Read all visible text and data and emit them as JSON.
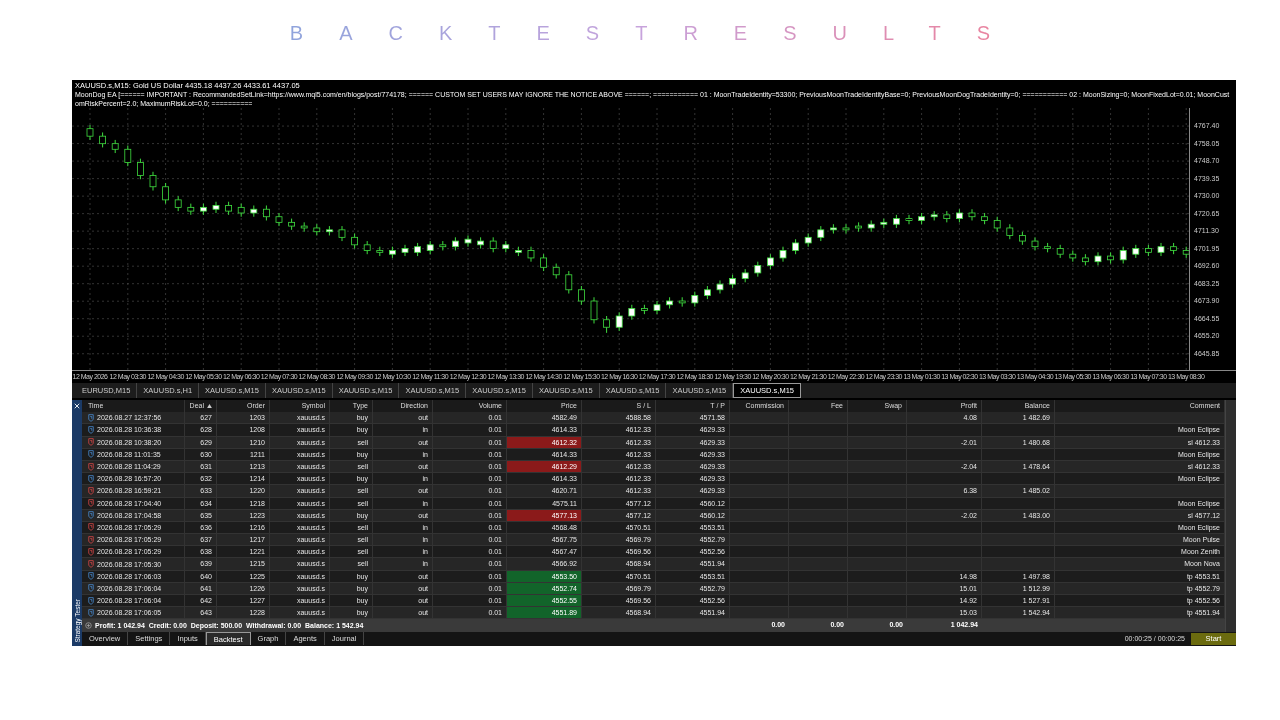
{
  "title": "BACKTESTRESULTS",
  "chart": {
    "symbol_line": "XAUUSD.s,M15:  Gold US Dollar  4435.18 4437.26 4433.61 4437.05",
    "ea_line": "MoonDog EA [====== IMPORTANT : RecommandedSetLink=https://www.mql5.com/en/blogs/post/774178; ====== CUSTOM SET USERS MAY IGNORE THE NOTICE ABOVE ======; =========== 01 : MoonTradeIdentity=53300; PreviousMoonTradeIdentityBase=0; PreviousMoonDogTradeIdentity=0; =========== 02 : MoonSizing=0; MoonFixedLot=0.01; MoonCustomRiskPercent=2.0; MaximumRiskLot=0.0; ==========",
    "chart_data": {
      "type": "candlestick",
      "grid": true,
      "ylim": [
        4637.17,
        4777.05
      ],
      "yticks": [
        {
          "value": 4767.4,
          "label": "4767.40"
        },
        {
          "value": 4758.05,
          "label": "4758.05"
        },
        {
          "value": 4748.7,
          "label": "4748.70"
        },
        {
          "value": 4739.35,
          "label": "4739.35"
        },
        {
          "value": 4730,
          "label": "4730.00"
        },
        {
          "value": 4720.65,
          "label": "4720.65"
        },
        {
          "value": 4711.3,
          "label": "4711.30"
        },
        {
          "value": 4701.95,
          "label": "4701.95"
        },
        {
          "value": 4692.6,
          "label": "4692.60"
        },
        {
          "value": 4683.25,
          "label": "4683.25"
        },
        {
          "value": 4673.9,
          "label": "4673.90"
        },
        {
          "value": 4664.55,
          "label": "4664.55"
        },
        {
          "value": 4655.2,
          "label": "4655.20"
        },
        {
          "value": 4645.85,
          "label": "4645.85"
        }
      ],
      "categories": [
        "12 May 2026",
        null,
        null,
        "12 May 03:30",
        null,
        null,
        "12 May 04:30",
        null,
        null,
        "12 May 05:30",
        null,
        null,
        "12 May 06:30",
        null,
        null,
        "12 May 07:30",
        null,
        null,
        "12 May 08:30",
        null,
        null,
        "12 May 09:30",
        null,
        null,
        "12 May 10:30",
        null,
        null,
        "12 May 11:30",
        null,
        null,
        "12 May 12:30",
        null,
        null,
        "12 May 13:30",
        null,
        null,
        "12 May 14:30",
        null,
        null,
        "12 May 15:30",
        null,
        null,
        "12 May 16:30",
        null,
        null,
        "12 May 17:30",
        null,
        null,
        "12 May 18:30",
        null,
        null,
        "12 May 19:30",
        null,
        null,
        "12 May 20:30",
        null,
        null,
        "12 May 21:30",
        null,
        null,
        "12 May 22:30",
        null,
        null,
        "12 May 23:30",
        null,
        null,
        "13 May 01:30",
        null,
        null,
        "13 May 02:30",
        null,
        null,
        "13 May 03:30",
        null,
        null,
        "13 May 04:30",
        null,
        null,
        "13 May 05:30",
        null,
        null,
        "13 May 06:30",
        null,
        null,
        "13 May 07:30",
        null,
        null,
        "13 May 08:30"
      ],
      "ohlc": [
        [
          4766,
          4768,
          4760,
          4762
        ],
        [
          4762,
          4764,
          4756,
          4758
        ],
        [
          4758,
          4760,
          4753,
          4755
        ],
        [
          4755,
          4757,
          4746,
          4748
        ],
        [
          4748,
          4750,
          4739,
          4741
        ],
        [
          4741,
          4743,
          4733,
          4735
        ],
        [
          4735,
          4737,
          4726,
          4728
        ],
        [
          4728,
          4730,
          4722,
          4724
        ],
        [
          4724,
          4726,
          4720,
          4722
        ],
        [
          4722,
          4726,
          4720,
          4724
        ],
        [
          4723,
          4727,
          4721,
          4725
        ],
        [
          4725,
          4727,
          4720,
          4722
        ],
        [
          4724,
          4726,
          4719,
          4721
        ],
        [
          4721,
          4725,
          4719,
          4723
        ],
        [
          4723,
          4725,
          4717,
          4719
        ],
        [
          4719,
          4721,
          4714,
          4716
        ],
        [
          4716,
          4718,
          4712,
          4714
        ],
        [
          4714,
          4716,
          4711,
          4713
        ],
        [
          4713,
          4715,
          4709,
          4711
        ],
        [
          4711,
          4714,
          4709,
          4712
        ],
        [
          4712,
          4714,
          4706,
          4708
        ],
        [
          4708,
          4710,
          4702,
          4704
        ],
        [
          4704,
          4706,
          4699,
          4701
        ],
        [
          4701,
          4703,
          4698,
          4700
        ],
        [
          4699,
          4703,
          4697,
          4701
        ],
        [
          4700,
          4704,
          4698,
          4702
        ],
        [
          4700,
          4705,
          4698,
          4703
        ],
        [
          4701,
          4706,
          4699,
          4704
        ],
        [
          4704,
          4706,
          4701,
          4703
        ],
        [
          4703,
          4708,
          4701,
          4706
        ],
        [
          4705,
          4709,
          4703,
          4707
        ],
        [
          4704,
          4708,
          4702,
          4706
        ],
        [
          4706,
          4708,
          4700,
          4702
        ],
        [
          4702,
          4706,
          4700,
          4704
        ],
        [
          4700,
          4703,
          4698,
          4701
        ],
        [
          4701,
          4703,
          4695,
          4697
        ],
        [
          4697,
          4699,
          4690,
          4692
        ],
        [
          4692,
          4694,
          4686,
          4688
        ],
        [
          4688,
          4690,
          4678,
          4680
        ],
        [
          4680,
          4682,
          4672,
          4674
        ],
        [
          4674,
          4676,
          4662,
          4664
        ],
        [
          4664,
          4666,
          4657,
          4660
        ],
        [
          4660,
          4668,
          4658,
          4666
        ],
        [
          4666,
          4672,
          4664,
          4670
        ],
        [
          4670,
          4672,
          4667,
          4669
        ],
        [
          4669,
          4674,
          4667,
          4672
        ],
        [
          4672,
          4676,
          4670,
          4674
        ],
        [
          4674,
          4676,
          4671,
          4673
        ],
        [
          4673,
          4679,
          4671,
          4677
        ],
        [
          4677,
          4682,
          4675,
          4680
        ],
        [
          4680,
          4685,
          4678,
          4683
        ],
        [
          4683,
          4688,
          4681,
          4686
        ],
        [
          4686,
          4691,
          4684,
          4689
        ],
        [
          4689,
          4695,
          4687,
          4693
        ],
        [
          4693,
          4699,
          4691,
          4697
        ],
        [
          4697,
          4703,
          4695,
          4701
        ],
        [
          4701,
          4707,
          4699,
          4705
        ],
        [
          4705,
          4710,
          4703,
          4708
        ],
        [
          4708,
          4714,
          4706,
          4712
        ],
        [
          4712,
          4715,
          4710,
          4713
        ],
        [
          4713,
          4715,
          4710,
          4712
        ],
        [
          4714,
          4716,
          4711,
          4713
        ],
        [
          4713,
          4717,
          4711,
          4715
        ],
        [
          4715,
          4718,
          4713,
          4716
        ],
        [
          4715,
          4720,
          4713,
          4718
        ],
        [
          4718,
          4720,
          4715,
          4717
        ],
        [
          4717,
          4721,
          4715,
          4719
        ],
        [
          4719,
          4722,
          4717,
          4720
        ],
        [
          4720,
          4722,
          4716,
          4718
        ],
        [
          4718,
          4723,
          4716,
          4721
        ],
        [
          4721,
          4723,
          4717,
          4719
        ],
        [
          4719,
          4721,
          4715,
          4717
        ],
        [
          4717,
          4719,
          4711,
          4713
        ],
        [
          4713,
          4715,
          4707,
          4709
        ],
        [
          4709,
          4711,
          4704,
          4706
        ],
        [
          4706,
          4708,
          4701,
          4703
        ],
        [
          4703,
          4705,
          4700,
          4702
        ],
        [
          4702,
          4704,
          4697,
          4699
        ],
        [
          4699,
          4701,
          4695,
          4697
        ],
        [
          4697,
          4699,
          4693,
          4695
        ],
        [
          4695,
          4700,
          4693,
          4698
        ],
        [
          4698,
          4700,
          4694,
          4696
        ],
        [
          4696,
          4703,
          4694,
          4701
        ],
        [
          4699,
          4704,
          4697,
          4702
        ],
        [
          4702,
          4704,
          4698,
          4700
        ],
        [
          4700,
          4705,
          4698,
          4703
        ],
        [
          4703,
          4705,
          4699,
          4701
        ],
        [
          4701,
          4703,
          4697,
          4699
        ]
      ]
    }
  },
  "chart_tabs": [
    {
      "label": "EURUSD,M15",
      "selected": false
    },
    {
      "label": "XAUUSD.s,H1",
      "selected": false
    },
    {
      "label": "XAUUSD.s,M15",
      "selected": false
    },
    {
      "label": "XAUUSD.s,M15",
      "selected": false
    },
    {
      "label": "XAUUSD.s,M15",
      "selected": false
    },
    {
      "label": "XAUUSD.s,M15",
      "selected": false
    },
    {
      "label": "XAUUSD.s,M15",
      "selected": false
    },
    {
      "label": "XAUUSD.s,M15",
      "selected": false
    },
    {
      "label": "XAUUSD.s,M15",
      "selected": false
    },
    {
      "label": "XAUUSD.s,M15",
      "selected": false
    },
    {
      "label": "XAUUSD.s,M15",
      "selected": true
    }
  ],
  "panel_title": "Strategy Tester",
  "table": {
    "columns": [
      "Time",
      "Deal",
      "Order",
      "Symbol",
      "Type",
      "Direction",
      "Volume",
      "Price",
      "S / L",
      "T / P",
      "Commission",
      "Fee",
      "Swap",
      "Profit",
      "Balance",
      "Comment"
    ],
    "rows": [
      {
        "kind": "buy",
        "time": "2026.08.27 12:37:56",
        "deal": "627",
        "order": "1203",
        "symbol": "xauusd.s",
        "type": "buy",
        "direction": "out",
        "volume": "0.01",
        "price": "4582.49",
        "sl": "4588.58",
        "tp": "4571.58",
        "profit": "4.08",
        "balance": "1 482.69"
      },
      {
        "kind": "buy",
        "time": "2026.08.28 10:36:38",
        "deal": "628",
        "order": "1208",
        "symbol": "xauusd.s",
        "type": "buy",
        "direction": "in",
        "volume": "0.01",
        "price": "4614.33",
        "sl": "4612.33",
        "tp": "4629.33",
        "comment": "Moon Eclipse"
      },
      {
        "kind": "sell",
        "time": "2026.08.28 10:38:20",
        "deal": "629",
        "order": "1210",
        "symbol": "xauusd.s",
        "type": "sell",
        "direction": "out",
        "volume": "0.01",
        "price": "4612.32",
        "color": "#8b1a1a",
        "sl": "4612.33",
        "tp": "4629.33",
        "profit": "-2.01",
        "balance": "1 480.68",
        "comment": "sl 4612.33"
      },
      {
        "kind": "buy",
        "time": "2026.08.28 11:01:35",
        "deal": "630",
        "order": "1211",
        "symbol": "xauusd.s",
        "type": "buy",
        "direction": "in",
        "volume": "0.01",
        "price": "4614.33",
        "sl": "4612.33",
        "tp": "4629.33",
        "comment": "Moon Eclipse"
      },
      {
        "kind": "sell",
        "time": "2026.08.28 11:04:29",
        "deal": "631",
        "order": "1213",
        "symbol": "xauusd.s",
        "type": "sell",
        "direction": "out",
        "volume": "0.01",
        "price": "4612.29",
        "color": "#8b1a1a",
        "sl": "4612.33",
        "tp": "4629.33",
        "profit": "-2.04",
        "balance": "1 478.64",
        "comment": "sl 4612.33"
      },
      {
        "kind": "buy",
        "time": "2026.08.28 16:57:20",
        "deal": "632",
        "order": "1214",
        "symbol": "xauusd.s",
        "type": "buy",
        "direction": "in",
        "volume": "0.01",
        "price": "4614.33",
        "sl": "4612.33",
        "tp": "4629.33",
        "comment": "Moon Eclipse"
      },
      {
        "kind": "sell",
        "time": "2026.08.28 16:59:21",
        "deal": "633",
        "order": "1220",
        "symbol": "xauusd.s",
        "type": "sell",
        "direction": "out",
        "volume": "0.01",
        "price": "4620.71",
        "sl": "4612.33",
        "tp": "4629.33",
        "profit": "6.38",
        "balance": "1 485.02"
      },
      {
        "kind": "sell",
        "time": "2026.08.28 17:04:40",
        "deal": "634",
        "order": "1218",
        "symbol": "xauusd.s",
        "type": "sell",
        "direction": "in",
        "volume": "0.01",
        "price": "4575.11",
        "sl": "4577.12",
        "tp": "4560.12",
        "comment": "Moon Eclipse"
      },
      {
        "kind": "buy",
        "time": "2026.08.28 17:04:58",
        "deal": "635",
        "order": "1223",
        "symbol": "xauusd.s",
        "type": "buy",
        "direction": "out",
        "volume": "0.01",
        "price": "4577.13",
        "color": "#8b1a1a",
        "sl": "4577.12",
        "tp": "4560.12",
        "profit": "-2.02",
        "balance": "1 483.00",
        "comment": "sl 4577.12"
      },
      {
        "kind": "sell",
        "time": "2026.08.28 17:05:29",
        "deal": "636",
        "order": "1216",
        "symbol": "xauusd.s",
        "type": "sell",
        "direction": "in",
        "volume": "0.01",
        "price": "4568.48",
        "sl": "4570.51",
        "tp": "4553.51",
        "comment": "Moon Eclipse"
      },
      {
        "kind": "sell",
        "time": "2026.08.28 17:05:29",
        "deal": "637",
        "order": "1217",
        "symbol": "xauusd.s",
        "type": "sell",
        "direction": "in",
        "volume": "0.01",
        "price": "4567.75",
        "sl": "4569.79",
        "tp": "4552.79",
        "comment": "Moon Pulse"
      },
      {
        "kind": "sell",
        "time": "2026.08.28 17:05:29",
        "deal": "638",
        "order": "1221",
        "symbol": "xauusd.s",
        "type": "sell",
        "direction": "in",
        "volume": "0.01",
        "price": "4567.47",
        "sl": "4569.56",
        "tp": "4552.56",
        "comment": "Moon Zenith"
      },
      {
        "kind": "sell",
        "time": "2026.08.28 17:05:30",
        "deal": "639",
        "order": "1215",
        "symbol": "xauusd.s",
        "type": "sell",
        "direction": "in",
        "volume": "0.01",
        "price": "4566.92",
        "sl": "4568.94",
        "tp": "4551.94",
        "comment": "Moon Nova"
      },
      {
        "kind": "buy",
        "time": "2026.08.28 17:06:03",
        "deal": "640",
        "order": "1225",
        "symbol": "xauusd.s",
        "type": "buy",
        "direction": "out",
        "volume": "0.01",
        "price": "4553.50",
        "color": "#12642a",
        "sl": "4570.51",
        "tp": "4553.51",
        "profit": "14.98",
        "balance": "1 497.98",
        "comment": "tp 4553.51"
      },
      {
        "kind": "buy",
        "time": "2026.08.28 17:06:04",
        "deal": "641",
        "order": "1226",
        "symbol": "xauusd.s",
        "type": "buy",
        "direction": "out",
        "volume": "0.01",
        "price": "4552.74",
        "color": "#12642a",
        "sl": "4569.79",
        "tp": "4552.79",
        "profit": "15.01",
        "balance": "1 512.99",
        "comment": "tp 4552.79"
      },
      {
        "kind": "buy",
        "time": "2026.08.28 17:06:04",
        "deal": "642",
        "order": "1227",
        "symbol": "xauusd.s",
        "type": "buy",
        "direction": "out",
        "volume": "0.01",
        "price": "4552.55",
        "color": "#12642a",
        "sl": "4569.56",
        "tp": "4552.56",
        "profit": "14.92",
        "balance": "1 527.91",
        "comment": "tp 4552.56"
      },
      {
        "kind": "buy",
        "time": "2026.08.28 17:06:05",
        "deal": "643",
        "order": "1228",
        "symbol": "xauusd.s",
        "type": "buy",
        "direction": "out",
        "volume": "0.01",
        "price": "4551.89",
        "color": "#12642a",
        "sl": "4568.94",
        "tp": "4551.94",
        "profit": "15.03",
        "balance": "1 542.94",
        "comment": "tp 4551.94"
      }
    ],
    "summary": {
      "text": "Profit: 1 042.94  Credit: 0.00  Deposit: 500.00  Withdrawal: 0.00  Balance: 1 542.94",
      "commission": "0.00",
      "fee": "0.00",
      "swap": "0.00",
      "profit": "1 042.94"
    }
  },
  "bottom_tabs": [
    {
      "label": "Overview",
      "selected": false
    },
    {
      "label": "Settings",
      "selected": false
    },
    {
      "label": "Inputs",
      "selected": false
    },
    {
      "label": "Backtest",
      "selected": true
    },
    {
      "label": "Graph",
      "selected": false
    },
    {
      "label": "Agents",
      "selected": false
    },
    {
      "label": "Journal",
      "selected": false
    }
  ],
  "timer": "00:00:25 / 00:00:25",
  "start_button": "Start"
}
